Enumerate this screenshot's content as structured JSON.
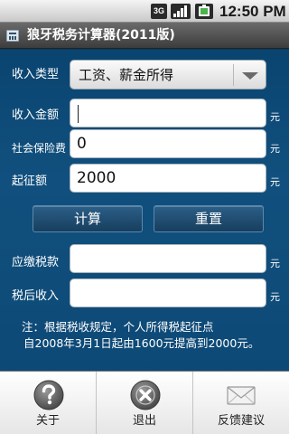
{
  "status_bar": {
    "network": "3G",
    "time": "12:50 PM",
    "icons": [
      "3g-icon",
      "signal-icon",
      "battery-icon"
    ]
  },
  "title_bar": {
    "title": "狼牙税务计算器(2011版)",
    "icon": "calculator-app-icon"
  },
  "form": {
    "income_type": {
      "label": "收入类型",
      "value": "工资、薪金所得"
    },
    "income_amount": {
      "label": "收入金额",
      "value": "",
      "unit": "元"
    },
    "social_insurance": {
      "label": "社会保险费",
      "value": "0",
      "unit": "元"
    },
    "threshold": {
      "label": "起征额",
      "value": "2000",
      "unit": "元"
    },
    "tax_payable": {
      "label": "应缴税款",
      "value": "",
      "unit": "元"
    },
    "after_tax_income": {
      "label": "税后收入",
      "value": "",
      "unit": "元"
    }
  },
  "buttons": {
    "calculate": "计算",
    "reset": "重置"
  },
  "note": {
    "line1": "注：根据税收规定，个人所得税起征点",
    "line2": "自2008年3月1日起由1600元提高到2000元。"
  },
  "menu": {
    "items": [
      {
        "label": "关于",
        "icon": "question-icon"
      },
      {
        "label": "退出",
        "icon": "close-icon"
      },
      {
        "label": "反馈建议",
        "icon": "envelope-icon"
      }
    ]
  },
  "colors": {
    "background": "#0c3a5e",
    "button": "#1f4b70",
    "title_bar": "#4a4a4a"
  }
}
